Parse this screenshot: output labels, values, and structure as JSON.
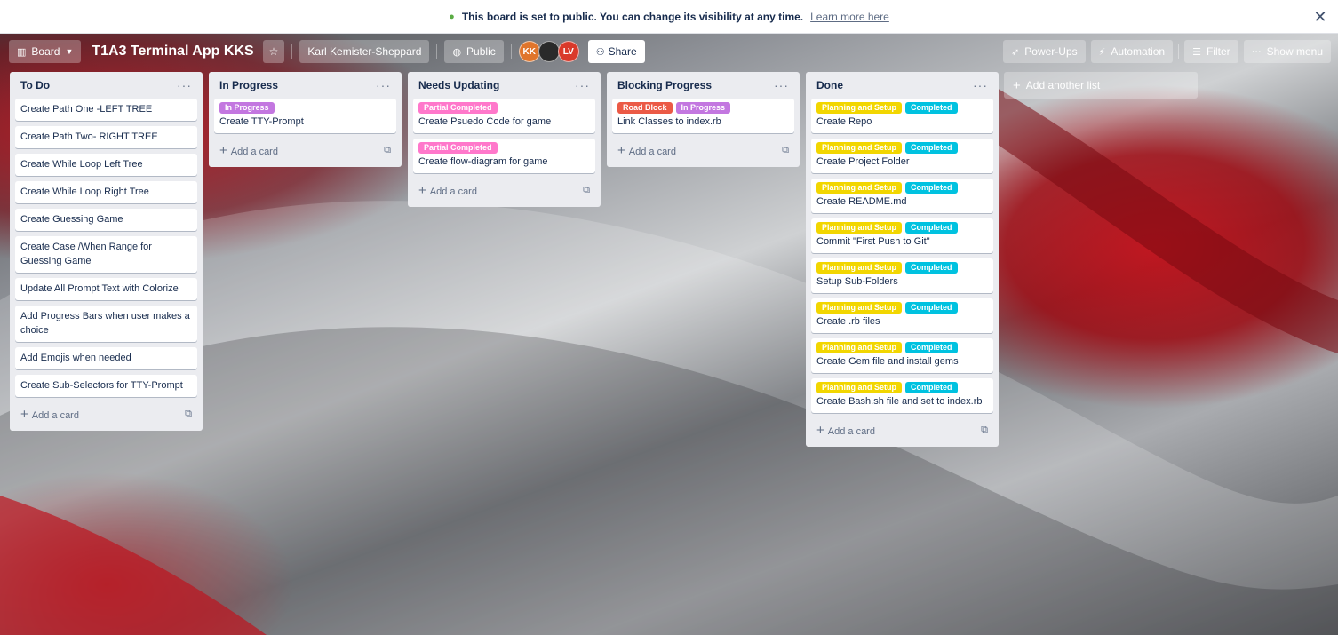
{
  "notice": {
    "message": "This board is set to public. You can change its visibility at any time.",
    "link": "Learn more here",
    "close": "✕"
  },
  "header": {
    "board_switcher": "Board",
    "title": "T1A3 Terminal App KKS",
    "workspace": "Karl Kemister-Sheppard",
    "visibility": "Public",
    "avatars": [
      {
        "initials": "KK",
        "color": "#e0752c"
      },
      {
        "initials": "",
        "color": "#2a2a2a"
      },
      {
        "initials": "LV",
        "color": "#d93a2b"
      }
    ],
    "share": "Share",
    "powerups": "Power-Ups",
    "automation": "Automation",
    "filter": "Filter",
    "show_menu": "Show menu"
  },
  "label_colors": {
    "In Progress": "#c377e0",
    "Partial Completed": "#ff78cb",
    "Road Block": "#eb5a46",
    "Planning and Setup": "#f2d600",
    "Completed": "#00c2e0"
  },
  "lists": [
    {
      "title": "To Do",
      "cards": [
        {
          "labels": [],
          "text": "Create Path One -LEFT TREE"
        },
        {
          "labels": [],
          "text": "Create Path Two- RIGHT TREE"
        },
        {
          "labels": [],
          "text": "Create While Loop Left Tree"
        },
        {
          "labels": [],
          "text": "Create While Loop Right Tree"
        },
        {
          "labels": [],
          "text": "Create Guessing Game"
        },
        {
          "labels": [],
          "text": "Create Case /When Range for Guessing Game"
        },
        {
          "labels": [],
          "text": "Update All Prompt Text with Colorize"
        },
        {
          "labels": [],
          "text": "Add Progress Bars when user makes a choice"
        },
        {
          "labels": [],
          "text": "Add Emojis when needed"
        },
        {
          "labels": [],
          "text": "Create Sub-Selectors for TTY-Prompt"
        }
      ],
      "add_card": "Add a card"
    },
    {
      "title": "In Progress",
      "cards": [
        {
          "labels": [
            "In Progress"
          ],
          "text": "Create TTY-Prompt"
        }
      ],
      "add_card": "Add a card"
    },
    {
      "title": "Needs Updating",
      "cards": [
        {
          "labels": [
            "Partial Completed"
          ],
          "text": "Create Psuedo Code for game"
        },
        {
          "labels": [
            "Partial Completed"
          ],
          "text": "Create flow-diagram for game"
        }
      ],
      "add_card": "Add a card"
    },
    {
      "title": "Blocking Progress",
      "cards": [
        {
          "labels": [
            "Road Block",
            "In Progress"
          ],
          "text": "Link Classes to index.rb"
        }
      ],
      "add_card": "Add a card"
    },
    {
      "title": "Done",
      "cards": [
        {
          "labels": [
            "Planning and Setup",
            "Completed"
          ],
          "text": "Create Repo"
        },
        {
          "labels": [
            "Planning and Setup",
            "Completed"
          ],
          "text": "Create Project Folder"
        },
        {
          "labels": [
            "Planning and Setup",
            "Completed"
          ],
          "text": "Create README.md"
        },
        {
          "labels": [
            "Planning and Setup",
            "Completed"
          ],
          "text": "Commit \"First Push to Git\""
        },
        {
          "labels": [
            "Planning and Setup",
            "Completed"
          ],
          "text": "Setup Sub-Folders"
        },
        {
          "labels": [
            "Planning and Setup",
            "Completed"
          ],
          "text": "Create .rb files"
        },
        {
          "labels": [
            "Planning and Setup",
            "Completed"
          ],
          "text": "Create Gem file and install gems"
        },
        {
          "labels": [
            "Planning and Setup",
            "Completed"
          ],
          "text": "Create Bash.sh file and set to index.rb"
        }
      ],
      "add_card": "Add a card"
    }
  ],
  "add_list": "Add another list"
}
